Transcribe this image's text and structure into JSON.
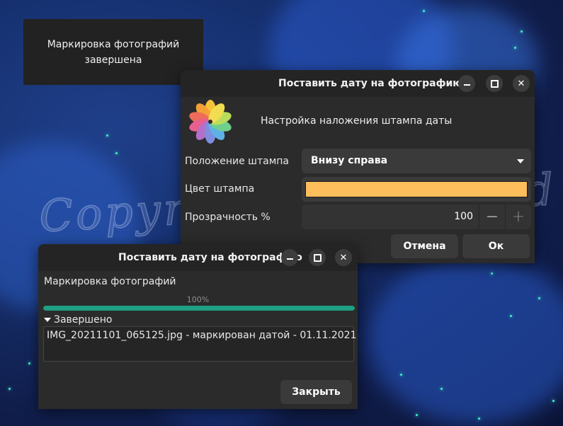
{
  "notification": {
    "line1": "Маркировка фотографий",
    "line2": "завершена"
  },
  "watermark": "Copyright © Vlasard",
  "dialog": {
    "title": "Поставить дату на фотографию",
    "heading": "Настройка наложения штампа даты",
    "position_label": "Положение штампа",
    "position_value": "Внизу справа",
    "color_label": "Цвет штампа",
    "color_value": "#ffbe5c",
    "opacity_label": "Прозрачность %",
    "opacity_value": "100",
    "minus_symbol": "−",
    "plus_symbol": "+",
    "cancel_label": "Отмена",
    "ok_label": "Ок",
    "minimize_icon": "minimize-icon",
    "maximize_icon": "maximize-icon",
    "close_symbol": "✕"
  },
  "progress": {
    "title": "Поставить дату на фотографию",
    "message": "Маркировка фотографий",
    "percent_text": "100%",
    "percent": 100,
    "expander_label": "Завершено",
    "log_lines": [
      "IMG_20211101_065125.jpg - маркирован датой - 01.11.2021"
    ],
    "close_label": "Закрыть",
    "close_symbol": "✕"
  },
  "colors": {
    "accent": "#1fa083",
    "window_bg": "#2b2b2b",
    "titlebar_bg": "#242424",
    "button_bg": "#3a3a3a",
    "stamp_color": "#ffbe5c"
  }
}
